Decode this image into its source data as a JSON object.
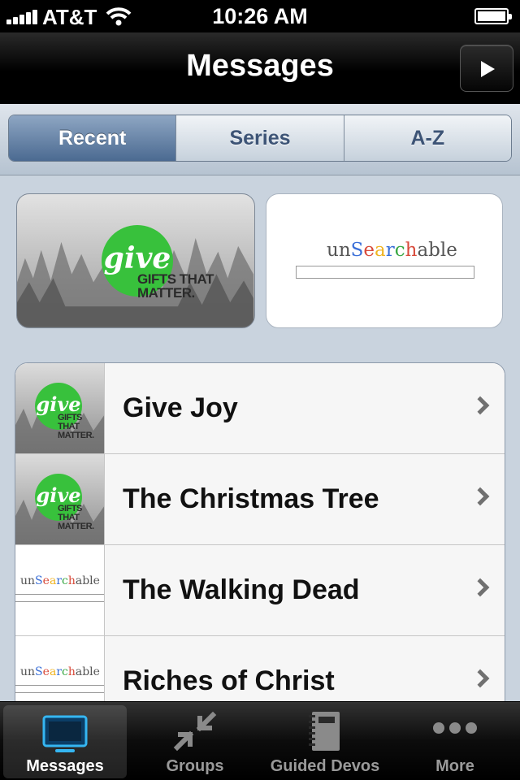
{
  "status_bar": {
    "carrier": "AT&T",
    "time": "10:26 AM"
  },
  "nav": {
    "title": "Messages",
    "play_icon": "play-icon"
  },
  "segments": [
    {
      "label": "Recent",
      "active": true
    },
    {
      "label": "Series",
      "active": false
    },
    {
      "label": "A-Z",
      "active": false
    }
  ],
  "features": {
    "give": {
      "logo": "give",
      "tagline_1": "GIFTS THAT",
      "tagline_2": "MATTER."
    },
    "unsearchable": {
      "logo": "unSearchable"
    }
  },
  "messages": [
    {
      "title": "Give Joy",
      "series": "give"
    },
    {
      "title": "The Christmas Tree",
      "series": "give"
    },
    {
      "title": "The Walking Dead",
      "series": "unSearchable"
    },
    {
      "title": "Riches of Christ",
      "series": "unSearchable"
    }
  ],
  "tabs": [
    {
      "label": "Messages",
      "icon": "monitor-icon",
      "active": true
    },
    {
      "label": "Groups",
      "icon": "collapse-arrows-icon",
      "active": false
    },
    {
      "label": "Guided Devos",
      "icon": "notebook-icon",
      "active": false
    },
    {
      "label": "More",
      "icon": "more-dots-icon",
      "active": false
    }
  ],
  "colors": {
    "give_green": "#38c13c",
    "segment_active": "#5b789e",
    "nav_dark": "#000000"
  }
}
